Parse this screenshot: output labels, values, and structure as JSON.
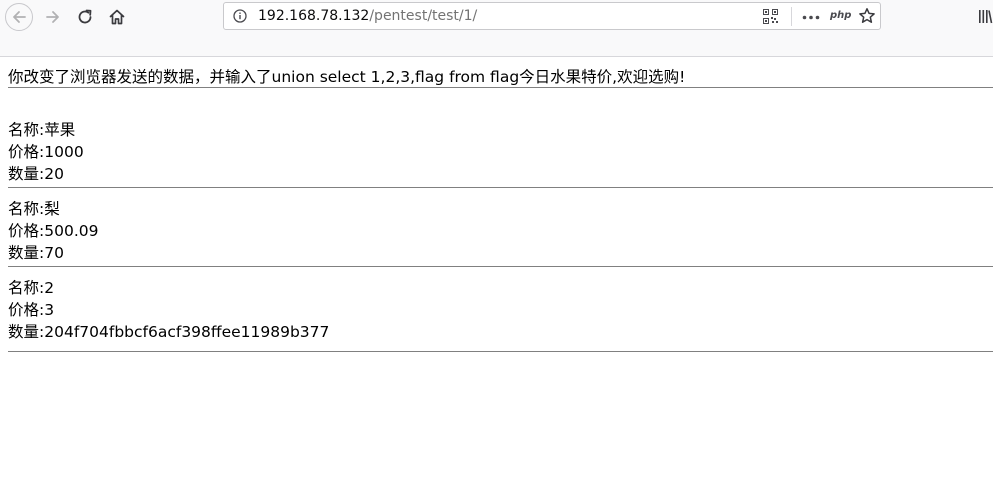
{
  "browser": {
    "url_host": "192.168.78.132",
    "url_path": "/pentest/test/1/",
    "icons": {
      "back": "back-arrow-icon",
      "forward": "forward-arrow-icon",
      "reload": "reload-icon",
      "home": "home-icon",
      "info": "info-icon",
      "qr": "qr-code-icon",
      "more": "more-icon",
      "php": "php-icon",
      "bookmark": "star-icon",
      "library": "library-icon"
    },
    "php_label": "php"
  },
  "page": {
    "headline": "你改变了浏览器发送的数据，并输入了union select 1,2,3,flag from flag今日水果特价,欢迎选购!",
    "products": [
      {
        "name_label": "名称:",
        "name": "苹果",
        "price_label": "价格:",
        "price": "1000",
        "qty_label": "数量:",
        "qty": "20"
      },
      {
        "name_label": "名称:",
        "name": "梨",
        "price_label": "价格:",
        "price": "500.09",
        "qty_label": "数量:",
        "qty": "70"
      },
      {
        "name_label": "名称:",
        "name": "2",
        "price_label": "价格:",
        "price": "3",
        "qty_label": "数量:",
        "qty": "204f704fbbcf6acf398ffee11989b377"
      }
    ]
  }
}
